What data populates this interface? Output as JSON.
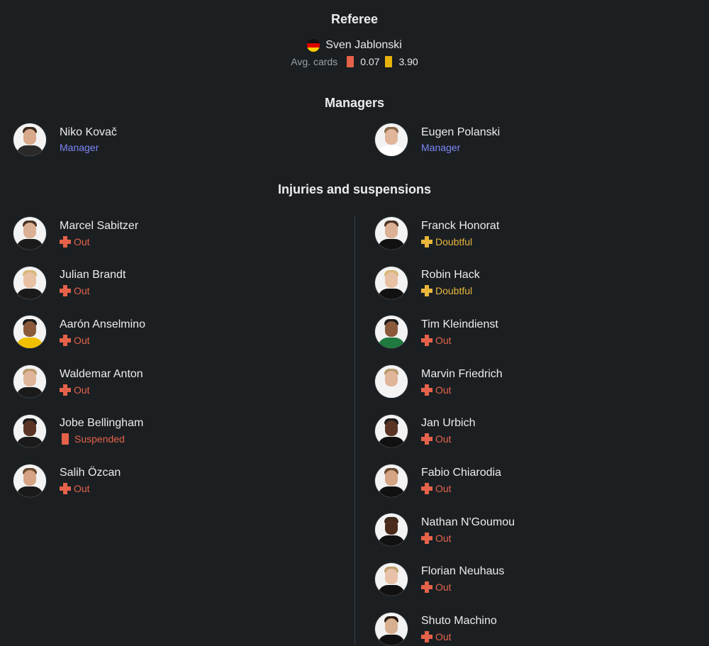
{
  "referee": {
    "title": "Referee",
    "name": "Sven Jablonski",
    "flag_icon": "germany-flag-icon",
    "avg_label": "Avg. cards",
    "red_avg": "0.07",
    "yellow_avg": "3.90"
  },
  "managers": {
    "title": "Managers",
    "home": {
      "name": "Niko Kovač",
      "role": "Manager"
    },
    "away": {
      "name": "Eugen Polanski",
      "role": "Manager"
    }
  },
  "injuries": {
    "title": "Injuries and suspensions",
    "home": [
      {
        "name": "Marcel Sabitzer",
        "status": "Out",
        "type": "out"
      },
      {
        "name": "Julian Brandt",
        "status": "Out",
        "type": "out"
      },
      {
        "name": "Aarón Anselmino",
        "status": "Out",
        "type": "out"
      },
      {
        "name": "Waldemar Anton",
        "status": "Out",
        "type": "out"
      },
      {
        "name": "Jobe Bellingham",
        "status": "Suspended",
        "type": "suspended"
      },
      {
        "name": "Salih Özcan",
        "status": "Out",
        "type": "out"
      }
    ],
    "away": [
      {
        "name": "Franck Honorat",
        "status": "Doubtful",
        "type": "doubtful"
      },
      {
        "name": "Robin Hack",
        "status": "Doubtful",
        "type": "doubtful"
      },
      {
        "name": "Tim Kleindienst",
        "status": "Out",
        "type": "out"
      },
      {
        "name": "Marvin Friedrich",
        "status": "Out",
        "type": "out"
      },
      {
        "name": "Jan Urbich",
        "status": "Out",
        "type": "out"
      },
      {
        "name": "Fabio Chiarodia",
        "status": "Out",
        "type": "out"
      },
      {
        "name": "Nathan N'Goumou",
        "status": "Out",
        "type": "out"
      },
      {
        "name": "Florian Neuhaus",
        "status": "Out",
        "type": "out"
      },
      {
        "name": "Shuto Machino",
        "status": "Out",
        "type": "out"
      }
    ]
  },
  "colors": {
    "background": "#1b1f22",
    "role": "#7d86f5",
    "out": "#e5624a",
    "doubtful": "#e9b63c",
    "red_card": "#e5624a",
    "yellow_card": "#e7b40c"
  }
}
